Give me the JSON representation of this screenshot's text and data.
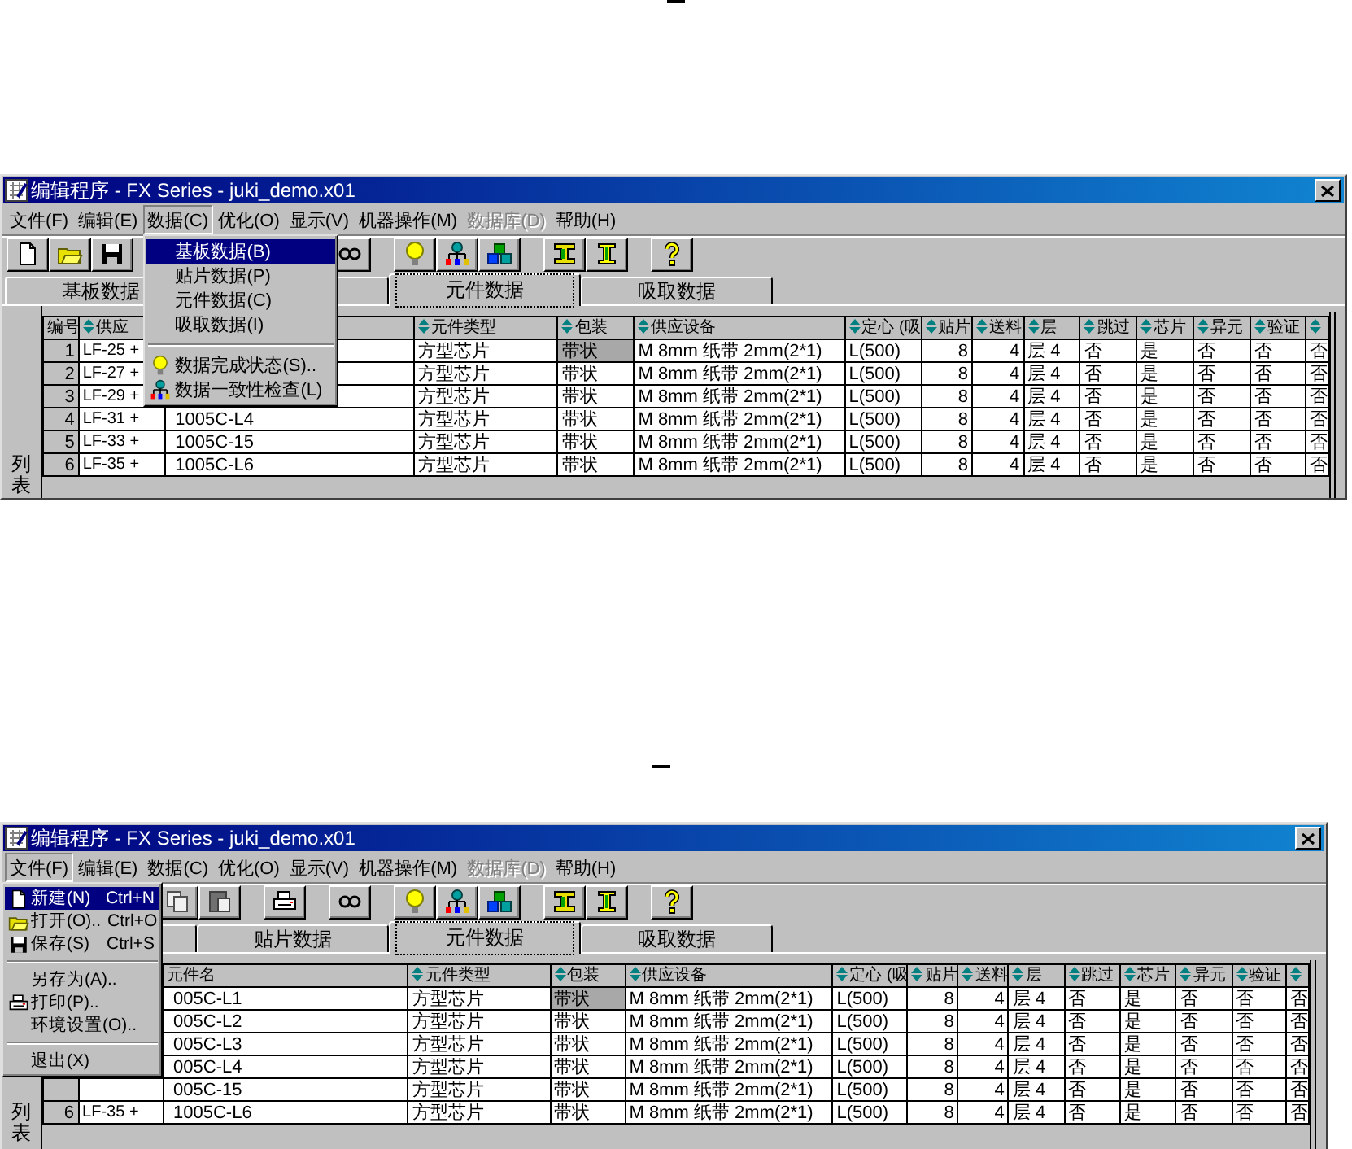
{
  "windows": [
    {
      "title": "编辑程序 - FX Series - juki_demo.x01",
      "menu_bar": [
        {
          "label": "文件(F)",
          "open": false,
          "disabled": false
        },
        {
          "label": "编辑(E)",
          "open": false,
          "disabled": false
        },
        {
          "label": "数据(C)",
          "open": true,
          "disabled": false
        },
        {
          "label": "优化(O)",
          "open": false,
          "disabled": false
        },
        {
          "label": "显示(V)",
          "open": false,
          "disabled": false
        },
        {
          "label": "机器操作(M)",
          "open": false,
          "disabled": false
        },
        {
          "label": "数据库(D)",
          "open": false,
          "disabled": true
        },
        {
          "label": "帮助(H)",
          "open": false,
          "disabled": false
        }
      ],
      "menu": [
        {
          "kind": "plain",
          "label": "基板数据(B)",
          "selected": true
        },
        {
          "kind": "plain",
          "label": "贴片数据(P)",
          "selected": false
        },
        {
          "kind": "plain",
          "label": "元件数据(C)",
          "selected": false
        },
        {
          "kind": "plain",
          "label": "吸取数据(I)",
          "selected": false
        },
        {
          "kind": "separator"
        },
        {
          "kind": "bulb",
          "label": "数据完成状态(S)..",
          "selected": false
        },
        {
          "kind": "network",
          "label": "数据一致性检查(L)",
          "selected": false
        }
      ],
      "toolbar": [
        {
          "kind": "new"
        },
        {
          "kind": "open"
        },
        {
          "kind": "save"
        },
        {
          "kind": "glasses"
        },
        {
          "kind": "bulb"
        },
        {
          "kind": "network"
        },
        {
          "kind": "shapes"
        },
        {
          "kind": "swap"
        },
        {
          "kind": "ibeam"
        },
        {
          "kind": "help"
        }
      ],
      "tabs": [
        {
          "label": "基板数据",
          "selected": false
        },
        {
          "selected": false
        },
        {
          "label": "元件数据",
          "selected": true
        },
        {
          "label": "吸取数据",
          "selected": false
        }
      ],
      "side_tab": "列表",
      "table": {
        "columns": [
          {
            "label": "编号",
            "sort_icon": false
          },
          {
            "label": "供应",
            "sort_icon": true
          },
          {},
          {
            "label": "元件类型",
            "sort_icon": true
          },
          {
            "label": "包装",
            "sort_icon": true
          },
          {
            "label": "供应设备",
            "sort_icon": true
          },
          {
            "label": "定心 (吸",
            "sort_icon": true
          },
          {
            "label": "贴片",
            "sort_icon": true
          },
          {
            "label": "送料",
            "sort_icon": true
          },
          {
            "label": "层",
            "sort_icon": true
          },
          {
            "label": "跳过",
            "sort_icon": true
          },
          {
            "label": "芯片",
            "sort_icon": true
          },
          {
            "label": "异元",
            "sort_icon": true
          },
          {
            "label": "验证",
            "sort_icon": true
          },
          {
            "sort_icon": true
          }
        ],
        "rows": [
          {
            "cells": [
              "1",
              "LF-25 +",
              null,
              "方型芯片",
              {
                "text": "带状",
                "selected": true
              },
              "M 8mm 纸带 2mm(2*1)",
              "L(500)",
              "8",
              "4",
              "层 4",
              "否",
              "是",
              "否",
              "否",
              "否"
            ]
          },
          {
            "cells": [
              "2",
              "LF-27 +",
              null,
              "方型芯片",
              {
                "text": "带状",
                "selected": false
              },
              "M 8mm 纸带 2mm(2*1)",
              "L(500)",
              "8",
              "4",
              "层 4",
              "否",
              "是",
              "否",
              "否",
              "否"
            ]
          },
          {
            "cells": [
              "3",
              "LF-29 +",
              null,
              "方型芯片",
              {
                "text": "带状",
                "selected": false
              },
              "M 8mm 纸带 2mm(2*1)",
              "L(500)",
              "8",
              "4",
              "层 4",
              "否",
              "是",
              "否",
              "否",
              "否"
            ]
          },
          {
            "cells": [
              "4",
              "LF-31 +",
              "1005C-L4",
              "方型芯片",
              {
                "text": "带状",
                "selected": false
              },
              "M 8mm 纸带 2mm(2*1)",
              "L(500)",
              "8",
              "4",
              "层 4",
              "否",
              "是",
              "否",
              "否",
              "否"
            ]
          },
          {
            "cells": [
              "5",
              "LF-33 +",
              "1005C-15",
              "方型芯片",
              {
                "text": "带状",
                "selected": false
              },
              "M 8mm 纸带 2mm(2*1)",
              "L(500)",
              "8",
              "4",
              "层 4",
              "否",
              "是",
              "否",
              "否",
              "否"
            ]
          },
          {
            "cells": [
              "6",
              "LF-35 +",
              "1005C-L6",
              "方型芯片",
              {
                "text": "带状",
                "selected": false
              },
              "M 8mm 纸带 2mm(2*1)",
              "L(500)",
              "8",
              "4",
              "层 4",
              "否",
              "是",
              "否",
              "否",
              "否"
            ]
          }
        ]
      }
    },
    {
      "title": "编辑程序 - FX Series - juki_demo.x01",
      "menu_bar": [
        {
          "label": "文件(F)",
          "open": true,
          "disabled": false
        },
        {
          "label": "编辑(E)",
          "open": false,
          "disabled": false
        },
        {
          "label": "数据(C)",
          "open": false,
          "disabled": false
        },
        {
          "label": "优化(O)",
          "open": false,
          "disabled": false
        },
        {
          "label": "显示(V)",
          "open": false,
          "disabled": false
        },
        {
          "label": "机器操作(M)",
          "open": false,
          "disabled": false
        },
        {
          "label": "数据库(D)",
          "open": false,
          "disabled": true
        },
        {
          "label": "帮助(H)",
          "open": false,
          "disabled": false
        }
      ],
      "menu": [
        {
          "kind": "new",
          "label": "新建(N)",
          "shortcut": "Ctrl+N",
          "selected": true
        },
        {
          "kind": "open",
          "label": "打开(O)..",
          "shortcut": "Ctrl+O",
          "selected": false
        },
        {
          "kind": "save",
          "label": "保存(S)",
          "shortcut": "Ctrl+S",
          "selected": false
        },
        {
          "kind": "separator"
        },
        {
          "kind": "plain",
          "label": "另存为(A)..",
          "selected": false
        },
        {
          "kind": "print",
          "label": "打印(P)..",
          "selected": false
        },
        {
          "kind": "plain",
          "label": "环境设置(O)..",
          "selected": false
        },
        {
          "kind": "separator"
        },
        {
          "kind": "plain",
          "label": "退出(X)",
          "selected": false
        }
      ],
      "toolbar": [
        {
          "kind": "copy"
        },
        {
          "kind": "paste"
        },
        {
          "kind": "print"
        },
        {
          "kind": "glasses"
        },
        {
          "kind": "bulb"
        },
        {
          "kind": "network"
        },
        {
          "kind": "shapes"
        },
        {
          "kind": "swap"
        },
        {
          "kind": "ibeam"
        },
        {
          "kind": "help"
        }
      ],
      "tabs": [
        {
          "selected": false
        },
        {
          "label": "贴片数据",
          "selected": false
        },
        {
          "label": "元件数据",
          "selected": true
        },
        {
          "label": "吸取数据",
          "selected": false
        }
      ],
      "side_tab": "列表",
      "table": {
        "columns": [
          {},
          {},
          {
            "label": "元件名",
            "sort_icon": false
          },
          {
            "label": "元件类型",
            "sort_icon": true
          },
          {
            "label": "包装",
            "sort_icon": true
          },
          {
            "label": "供应设备",
            "sort_icon": true
          },
          {
            "label": "定心 (吸",
            "sort_icon": true
          },
          {
            "label": "贴片",
            "sort_icon": true
          },
          {
            "label": "送料",
            "sort_icon": true
          },
          {
            "label": "层",
            "sort_icon": true
          },
          {
            "label": "跳过",
            "sort_icon": true
          },
          {
            "label": "芯片",
            "sort_icon": true
          },
          {
            "label": "异元",
            "sort_icon": true
          },
          {
            "label": "验证",
            "sort_icon": true
          },
          {
            "sort_icon": true
          }
        ],
        "rows": [
          {
            "cells": [
              null,
              null,
              "005C-L1",
              "方型芯片",
              {
                "text": "带状",
                "selected": true
              },
              "M 8mm 纸带 2mm(2*1)",
              "L(500)",
              "8",
              "4",
              "层 4",
              "否",
              "是",
              "否",
              "否",
              "否"
            ]
          },
          {
            "cells": [
              null,
              null,
              "005C-L2",
              "方型芯片",
              {
                "text": "带状",
                "selected": false
              },
              "M 8mm 纸带 2mm(2*1)",
              "L(500)",
              "8",
              "4",
              "层 4",
              "否",
              "是",
              "否",
              "否",
              "否"
            ]
          },
          {
            "cells": [
              null,
              null,
              "005C-L3",
              "方型芯片",
              {
                "text": "带状",
                "selected": false
              },
              "M 8mm 纸带 2mm(2*1)",
              "L(500)",
              "8",
              "4",
              "层 4",
              "否",
              "是",
              "否",
              "否",
              "否"
            ]
          },
          {
            "cells": [
              null,
              null,
              "005C-L4",
              "方型芯片",
              {
                "text": "带状",
                "selected": false
              },
              "M 8mm 纸带 2mm(2*1)",
              "L(500)",
              "8",
              "4",
              "层 4",
              "否",
              "是",
              "否",
              "否",
              "否"
            ]
          },
          {
            "cells": [
              null,
              null,
              "005C-15",
              "方型芯片",
              {
                "text": "带状",
                "selected": false
              },
              "M 8mm 纸带 2mm(2*1)",
              "L(500)",
              "8",
              "4",
              "层 4",
              "否",
              "是",
              "否",
              "否",
              "否"
            ]
          },
          {
            "cells": [
              "6",
              "LF-35 +",
              "1005C-L6",
              "方型芯片",
              {
                "text": "带状",
                "selected": false
              },
              "M 8mm 纸带 2mm(2*1)",
              "L(500)",
              "8",
              "4",
              "层 4",
              "否",
              "是",
              "否",
              "否",
              "否"
            ]
          }
        ]
      }
    }
  ]
}
